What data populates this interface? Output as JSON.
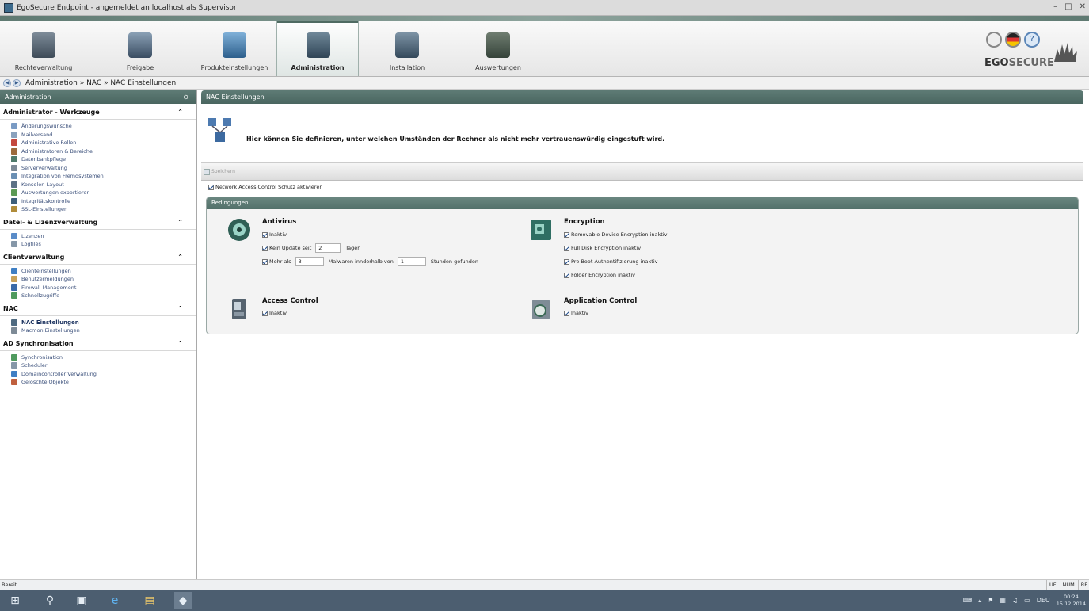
{
  "window": {
    "title": "EgoSecure Endpoint - angemeldet an localhost als Supervisor",
    "controls": [
      "_",
      "&#x1F5D7;",
      "X"
    ]
  },
  "ribbon": {
    "tabs": [
      {
        "label": "Rechteverwaltung",
        "icon": "rights-management-icon",
        "active": false
      },
      {
        "label": "Freigabe",
        "icon": "release-icon",
        "active": false
      },
      {
        "label": "Produkteinstellungen",
        "icon": "product-settings-icon",
        "active": false
      },
      {
        "label": "Administration",
        "icon": "administration-icon",
        "active": true
      },
      {
        "label": "Installation",
        "icon": "installation-icon",
        "active": false
      },
      {
        "label": "Auswertungen",
        "icon": "reports-icon",
        "active": false
      }
    ],
    "brand": {
      "ego": "EGO",
      "secure": "SECURE"
    }
  },
  "breadcrumb": {
    "text": "Administration » NAC » NAC Einstellungen"
  },
  "sidebar": {
    "title": "Administration",
    "pin": "⊙",
    "groups": [
      {
        "title": "Administrator - Werkzeuge",
        "items": [
          "Änderungswünsche",
          "Mailversand",
          "Administrative Rollen",
          "Administratoren & Bereiche",
          "Datenbankpflege",
          "Serververwaltung",
          "Integration von Fremdsystemen",
          "Konsolen-Layout",
          "Auswertungen exportieren",
          "Integritätskontrolle",
          "SSL-Einstellungen"
        ]
      },
      {
        "title": "Datei- & Lizenzverwaltung",
        "items": [
          "Lizenzen",
          "Logfiles"
        ]
      },
      {
        "title": "Clientverwaltung",
        "items": [
          "Clienteinstellungen",
          "Benutzermeldungen",
          "Firewall Management",
          "Schnellzugriffe"
        ]
      },
      {
        "title": "NAC",
        "items": [
          "NAC Einstellungen",
          "Macmon Einstellungen"
        ]
      },
      {
        "title": "AD Synchronisation",
        "items": [
          "Synchronisation",
          "Scheduler",
          "Domaincontroller Verwaltung",
          "Gelöschte Objekte"
        ]
      }
    ],
    "collapse_glyph": "»"
  },
  "content": {
    "title": "NAC Einstellungen",
    "description": "Hier können Sie definieren, unter welchen Umständen der Rechner als nicht mehr vertrauenswürdig eingestuft wird.",
    "save_label": "Speichern",
    "nac_toggle": "Network Access Control Schutz aktivieren",
    "conditions_title": "Bedingungen",
    "antivirus": {
      "title": "Antivirus",
      "inaktiv": "Inaktiv",
      "kein_update_label": "Kein Update seit",
      "kein_update_value": "2",
      "tagen": "Tagen",
      "mehr_als": "Mehr als",
      "malware_value": "3",
      "malware_text": "Malwaren innderhalb von",
      "hours_value": "1",
      "hours_text": "Stunden gefunden"
    },
    "encryption": {
      "title": "Encryption",
      "options": [
        "Removable Device Encryption inaktiv",
        "Full Disk Encryption inaktiv",
        "Pre-Boot Authentifizierung inaktiv",
        "Folder Encryption inaktiv"
      ]
    },
    "access_control": {
      "title": "Access Control",
      "inaktiv": "Inaktiv"
    },
    "application_control": {
      "title": "Application Control",
      "inaktiv": "Inaktiv"
    }
  },
  "statusbar": {
    "text": "Bereit",
    "indicators": [
      "UF",
      "NUM",
      "RF"
    ]
  },
  "taskbar": {
    "lang": "DEU",
    "time": "00:24",
    "date": "15.12.2014"
  }
}
